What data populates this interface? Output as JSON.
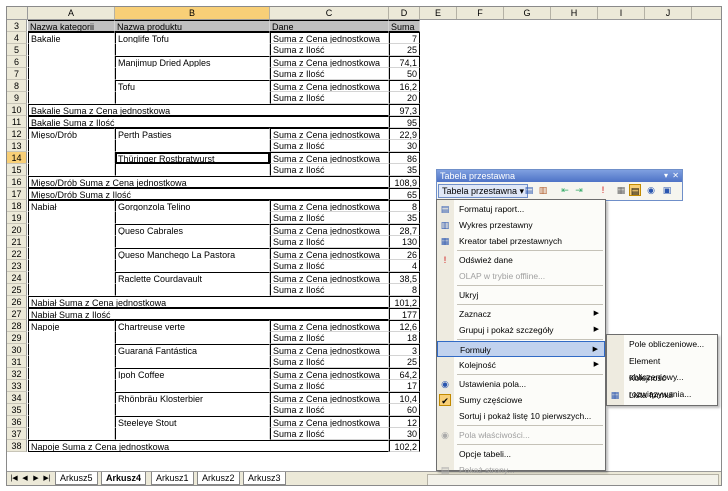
{
  "columns": [
    "A",
    "B",
    "C",
    "D",
    "E",
    "F",
    "G",
    "H",
    "I",
    "J"
  ],
  "header_row": {
    "row": "3",
    "a": "Nazwa kategorii",
    "b": "Nazwa produktu",
    "c": "Dane",
    "d": "Suma"
  },
  "rows": [
    {
      "n": "4",
      "a": "Bakalie",
      "b": "Longlife Tofu",
      "c": "Suma z Cena jednostkowa",
      "d": "7"
    },
    {
      "n": "5",
      "a": "",
      "b": "",
      "c": "Suma z Ilość",
      "d": "25"
    },
    {
      "n": "6",
      "a": "",
      "b": "Manjimup Dried Apples",
      "c": "Suma z Cena jednostkowa",
      "d": "74,1"
    },
    {
      "n": "7",
      "a": "",
      "b": "",
      "c": "Suma z Ilość",
      "d": "50"
    },
    {
      "n": "8",
      "a": "",
      "b": "Tofu",
      "c": "Suma z Cena jednostkowa",
      "d": "16,2"
    },
    {
      "n": "9",
      "a": "",
      "b": "",
      "c": "Suma z Ilość",
      "d": "20"
    },
    {
      "n": "10",
      "a": "Bakalie Suma z Cena jednostkowa",
      "b": "",
      "c": "",
      "d": "97,3"
    },
    {
      "n": "11",
      "a": "Bakalie Suma z Ilość",
      "b": "",
      "c": "",
      "d": "95"
    },
    {
      "n": "12",
      "a": "Mięso/Drób",
      "b": "Perth Pasties",
      "c": "Suma z Cena jednostkowa",
      "d": "22,9"
    },
    {
      "n": "13",
      "a": "",
      "b": "",
      "c": "Suma z Ilość",
      "d": "30"
    },
    {
      "n": "14",
      "a": "",
      "b": "Thüringer Rostbratwurst",
      "c": "Suma z Cena jednostkowa",
      "d": "86"
    },
    {
      "n": "15",
      "a": "",
      "b": "",
      "c": "Suma z Ilość",
      "d": "35"
    },
    {
      "n": "16",
      "a": "Mięso/Drób Suma z Cena jednostkowa",
      "b": "",
      "c": "",
      "d": "108,9"
    },
    {
      "n": "17",
      "a": "Mięso/Drób Suma z Ilość",
      "b": "",
      "c": "",
      "d": "65"
    },
    {
      "n": "18",
      "a": "Nabiał",
      "b": "Gorgonzola Telino",
      "c": "Suma z Cena jednostkowa",
      "d": "8"
    },
    {
      "n": "19",
      "a": "",
      "b": "",
      "c": "Suma z Ilość",
      "d": "35"
    },
    {
      "n": "20",
      "a": "",
      "b": "Queso Cabrales",
      "c": "Suma z Cena jednostkowa",
      "d": "28,7"
    },
    {
      "n": "21",
      "a": "",
      "b": "",
      "c": "Suma z Ilość",
      "d": "130"
    },
    {
      "n": "22",
      "a": "",
      "b": "Queso Manchego La Pastora",
      "c": "Suma z Cena jednostkowa",
      "d": "26"
    },
    {
      "n": "23",
      "a": "",
      "b": "",
      "c": "Suma z Ilość",
      "d": "4"
    },
    {
      "n": "24",
      "a": "",
      "b": "Raclette Courdavault",
      "c": "Suma z Cena jednostkowa",
      "d": "38,5"
    },
    {
      "n": "25",
      "a": "",
      "b": "",
      "c": "Suma z Ilość",
      "d": "8"
    },
    {
      "n": "26",
      "a": "Nabiał Suma z Cena jednostkowa",
      "b": "",
      "c": "",
      "d": "101,2"
    },
    {
      "n": "27",
      "a": "Nabiał Suma z Ilość",
      "b": "",
      "c": "",
      "d": "177"
    },
    {
      "n": "28",
      "a": "Napoje",
      "b": "Chartreuse verte",
      "c": "Suma z Cena jednostkowa",
      "d": "12,6"
    },
    {
      "n": "29",
      "a": "",
      "b": "",
      "c": "Suma z Ilość",
      "d": "18"
    },
    {
      "n": "30",
      "a": "",
      "b": "Guaraná Fantástica",
      "c": "Suma z Cena jednostkowa",
      "d": "3"
    },
    {
      "n": "31",
      "a": "",
      "b": "",
      "c": "Suma z Ilość",
      "d": "25"
    },
    {
      "n": "32",
      "a": "",
      "b": "Ipoh Coffee",
      "c": "Suma z Cena jednostkowa",
      "d": "64,2"
    },
    {
      "n": "33",
      "a": "",
      "b": "",
      "c": "Suma z Ilość",
      "d": "17"
    },
    {
      "n": "34",
      "a": "",
      "b": "Rhönbräu Klosterbier",
      "c": "Suma z Cena jednostkowa",
      "d": "10,4"
    },
    {
      "n": "35",
      "a": "",
      "b": "",
      "c": "Suma z Ilość",
      "d": "60"
    },
    {
      "n": "36",
      "a": "",
      "b": "Steeleye Stout",
      "c": "Suma z Cena jednostkowa",
      "d": "12"
    },
    {
      "n": "37",
      "a": "",
      "b": "",
      "c": "Suma z Ilość",
      "d": "30"
    },
    {
      "n": "38",
      "a": "Napoje Suma z Cena jednostkowa",
      "b": "",
      "c": "",
      "d": "102,2"
    }
  ],
  "sheet_tabs": [
    "Arkusz5",
    "Arkusz4",
    "Arkusz1",
    "Arkusz2",
    "Arkusz3"
  ],
  "active_tab": "Arkusz4",
  "pivot_toolbar": {
    "title": "Tabela przestawna",
    "menu_label": "Tabela przestawna ▾"
  },
  "menu": {
    "items": [
      {
        "label": "Formatuj raport...",
        "icon": "format-report-icon",
        "glyph": "▤",
        "disabled": false
      },
      {
        "label": "Wykres przestawny",
        "icon": "pivot-chart-icon",
        "glyph": "▥",
        "disabled": false
      },
      {
        "label": "Kreator tabel przestawnych",
        "icon": "wizard-icon",
        "glyph": "▦",
        "disabled": false
      },
      {
        "label": "Odśwież dane",
        "icon": "refresh-icon",
        "glyph": "!",
        "disabled": false
      },
      {
        "label": "OLAP w trybie offline...",
        "icon": "",
        "glyph": "",
        "disabled": true
      },
      {
        "label": "Ukryj",
        "icon": "",
        "glyph": "",
        "disabled": false
      },
      {
        "label": "Zaznacz",
        "icon": "",
        "glyph": "",
        "disabled": false,
        "submenu": true
      },
      {
        "label": "Grupuj i pokaż szczegóły",
        "icon": "",
        "glyph": "",
        "disabled": false,
        "submenu": true
      },
      {
        "label": "Formuły",
        "icon": "",
        "glyph": "",
        "disabled": false,
        "submenu": true,
        "highlighted": true
      },
      {
        "label": "Kolejność",
        "icon": "",
        "glyph": "",
        "disabled": false,
        "submenu": true
      },
      {
        "label": "Ustawienia pola...",
        "icon": "field-settings-icon",
        "glyph": "◉",
        "disabled": false
      },
      {
        "label": "Sumy częściowe",
        "icon": "check-icon",
        "glyph": "✔",
        "disabled": false
      },
      {
        "label": "Sortuj i pokaż listę 10 pierwszych...",
        "icon": "",
        "glyph": "",
        "disabled": false
      },
      {
        "label": "Pola właściwości...",
        "icon": "property-fields-icon",
        "glyph": "◉",
        "disabled": true
      },
      {
        "label": "Opcje tabeli...",
        "icon": "",
        "glyph": "",
        "disabled": false
      },
      {
        "label": "Pokaż strony...",
        "icon": "show-pages-icon",
        "glyph": "▤",
        "disabled": true
      }
    ]
  },
  "submenu": {
    "items": [
      {
        "label": "Pole obliczeniowe...",
        "glyph": ""
      },
      {
        "label": "Element obliczeniowy...",
        "glyph": ""
      },
      {
        "label": "Kolejność rozwiązywania...",
        "glyph": ""
      },
      {
        "label": "Lista formuł",
        "glyph": "▦"
      }
    ]
  },
  "colors": {
    "selected_header": "#f8cf77",
    "header_bg": "#ece9d8",
    "menu_highlight": "#c1d2ee",
    "toolbar_title": "#4e72c6"
  }
}
